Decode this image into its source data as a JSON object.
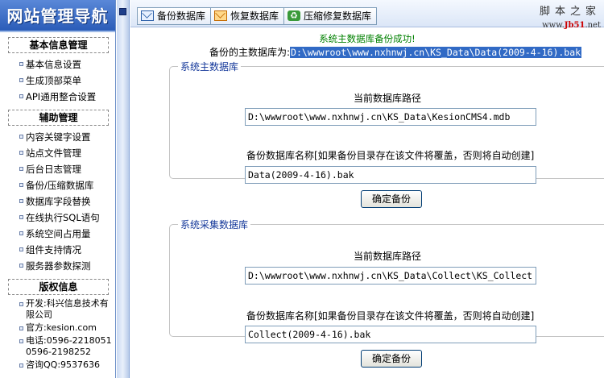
{
  "sidebar": {
    "logo": "网站管理导航",
    "sections": [
      {
        "title": "基本信息管理",
        "items": [
          "基本信息设置",
          "生成顶部菜单",
          "API通用整合设置"
        ]
      },
      {
        "title": "辅助管理",
        "items": [
          "内容关键字设置",
          "站点文件管理",
          "后台日志管理",
          "备份/压缩数据库",
          "数据库字段替换",
          "在线执行SQL语句",
          "系统空间占用量",
          "组件支持情况",
          "服务器参数探测"
        ]
      },
      {
        "title": "版权信息",
        "info": [
          "开发:科兴信息技术有限公司",
          "官方:kesion.com",
          "电话:0596-2218051 0596-2198252",
          "咨询QQ:9537636"
        ]
      }
    ]
  },
  "toolbar": {
    "backup": "备份数据库",
    "restore": "恢复数据库",
    "compact": "压缩修复数据库"
  },
  "brand": {
    "name": "脚本之家",
    "url_prefix": "www.",
    "url_mid": "Jb51",
    "url_suffix": ".net"
  },
  "status": {
    "success": "系统主数据库备份成功!",
    "backup_label": "备份的主数据库为:",
    "backup_path": "D:\\wwwroot\\www.nxhnwj.cn\\KS_Data\\Data(2009-4-16).bak"
  },
  "main_db": {
    "legend": "系统主数据库",
    "path_label": "当前数据库路径",
    "path_value": "D:\\wwwroot\\www.nxhnwj.cn\\KS_Data\\KesionCMS4.mdb",
    "name_label": "备份数据库名称[如果备份目录存在该文件将覆盖，否则将自动创建]",
    "name_value": "Data(2009-4-16).bak",
    "button": "确定备份"
  },
  "collect_db": {
    "legend": "系统采集数据库",
    "path_label": "当前数据库路径",
    "path_value": "D:\\wwwroot\\www.nxhnwj.cn\\KS_Data\\Collect\\KS_Collect",
    "name_label": "备份数据库名称[如果备份目录存在该文件将覆盖，否则将自动创建]",
    "name_value": "Collect(2009-4-16).bak",
    "button": "确定备份"
  }
}
